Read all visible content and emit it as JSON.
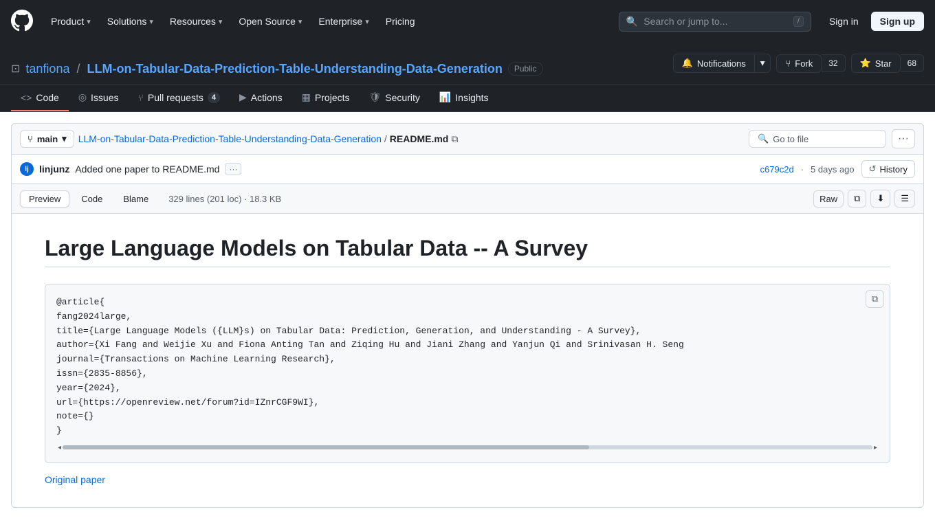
{
  "nav": {
    "logo_label": "GitHub",
    "items": [
      {
        "label": "Product",
        "has_dropdown": true
      },
      {
        "label": "Solutions",
        "has_dropdown": true
      },
      {
        "label": "Resources",
        "has_dropdown": true
      },
      {
        "label": "Open Source",
        "has_dropdown": true
      },
      {
        "label": "Enterprise",
        "has_dropdown": true
      },
      {
        "label": "Pricing",
        "has_dropdown": false
      }
    ],
    "search_placeholder": "Search or jump to...",
    "search_shortcut": "/",
    "signin_label": "Sign in",
    "signup_label": "Sign up"
  },
  "repo": {
    "owner": "tanfiona",
    "separator": "/",
    "name": "LLM-on-Tabular-Data-Prediction-Table-Understanding-Data-Generation",
    "badge": "Public",
    "notifications_label": "Notifications",
    "fork_label": "Fork",
    "fork_count": "32",
    "star_label": "Star",
    "star_count": "68"
  },
  "tabs": [
    {
      "label": "Code",
      "icon": "code-icon",
      "active": true
    },
    {
      "label": "Issues",
      "icon": "issue-icon",
      "active": false
    },
    {
      "label": "Pull requests",
      "icon": "pr-icon",
      "badge": "4",
      "active": false
    },
    {
      "label": "Actions",
      "icon": "actions-icon",
      "active": false
    },
    {
      "label": "Projects",
      "icon": "projects-icon",
      "active": false
    },
    {
      "label": "Security",
      "icon": "security-icon",
      "active": false
    },
    {
      "label": "Insights",
      "icon": "insights-icon",
      "active": false
    }
  ],
  "file_bar": {
    "branch": "main",
    "path_root": "LLM-on-Tabular-Data-Prediction-Table-Understanding-Data-Generation",
    "path_separator": "/",
    "path_file": "README.md",
    "go_to_file_placeholder": "Go to file",
    "more_options": "..."
  },
  "commit": {
    "author": "linjunz",
    "avatar_initials": "lj",
    "message": "Added one paper to README.md",
    "sha": "c679c2d",
    "time": "5 days ago",
    "history_label": "History"
  },
  "file_view": {
    "tabs": [
      "Preview",
      "Code",
      "Blame"
    ],
    "active_tab": "Preview",
    "info": "329 lines (201 loc) · 18.3 KB",
    "raw_label": "Raw",
    "copy_label": "Copy",
    "download_label": "Download",
    "list_label": "List"
  },
  "markdown": {
    "title": "Large Language Models on Tabular Data -- A Survey",
    "code_block": "@article{\nfang2024large,\ntitle={Large Language Models ({LLM}s) on Tabular Data: Prediction, Generation, and Understanding - A Survey},\nauthor={Xi Fang and Weijie Xu and Fiona Anting Tan and Ziqing Hu and Jiani Zhang and Yanjun Qi and Srinivasan H. Seng\njournal={Transactions on Machine Learning Research},\nissn={2835-8856},\nyear={2024},\nurl={https://openreview.net/forum?id=IZnrCGF9WI},\nnote={}\n}",
    "original_paper_label": "Original paper"
  }
}
